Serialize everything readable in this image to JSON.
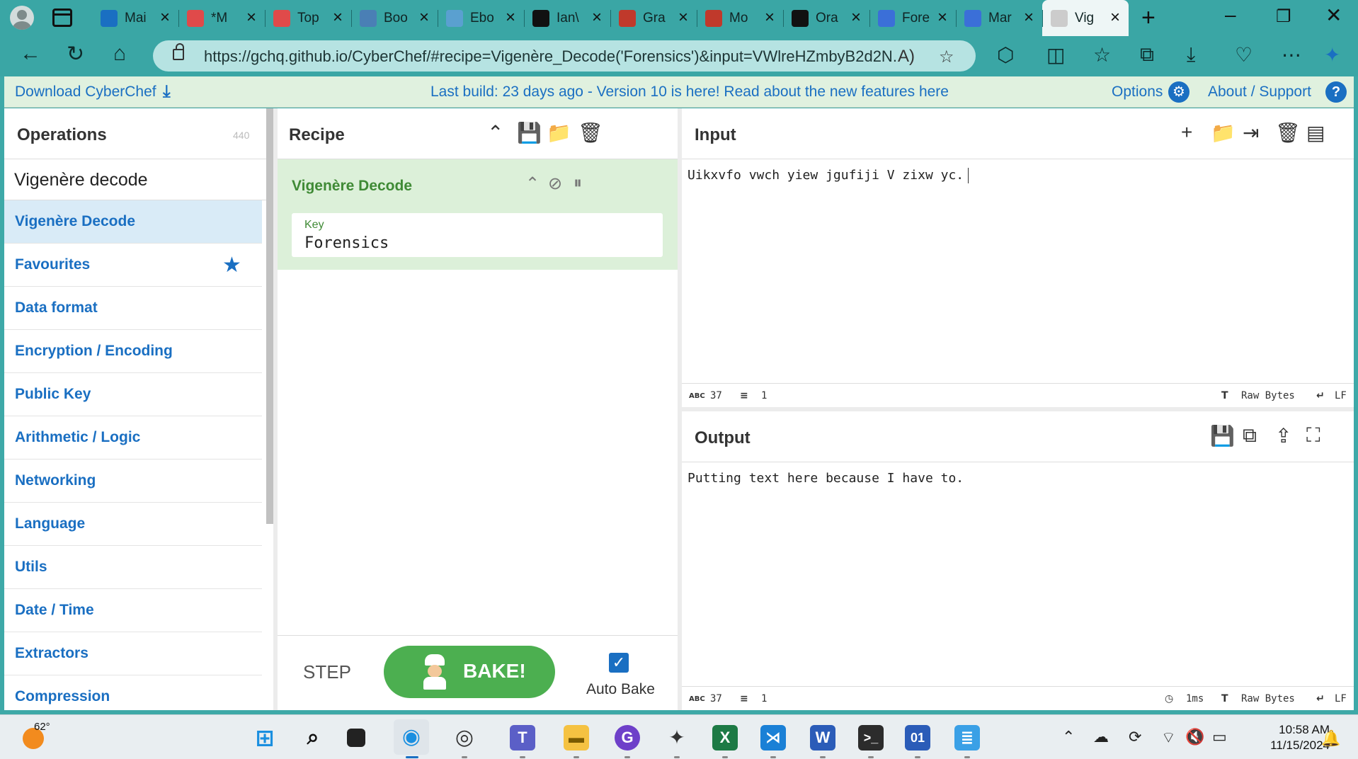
{
  "browser": {
    "tabs": [
      {
        "title": "Mai",
        "favicon_color": "#1a6fc2",
        "icon": "outlook-icon"
      },
      {
        "title": "*M",
        "favicon_color": "#e04a4a",
        "icon": "gear-favicon-icon"
      },
      {
        "title": "Top",
        "favicon_color": "#e04a4a",
        "icon": "gear-favicon-icon"
      },
      {
        "title": "Boo",
        "favicon_color": "#4a7fb5",
        "icon": "bookmark-favicon-icon"
      },
      {
        "title": "Ebo",
        "favicon_color": "#5aa0d0",
        "icon": "book-favicon-icon"
      },
      {
        "title": "Ian\\",
        "favicon_color": "#111111",
        "icon": "github-icon"
      },
      {
        "title": "Gra",
        "favicon_color": "#c0392b",
        "icon": "gear-favicon-icon"
      },
      {
        "title": "Mo",
        "favicon_color": "#c0392b",
        "icon": "gear-favicon-icon"
      },
      {
        "title": "Ora",
        "favicon_color": "#111111",
        "icon": "chatgpt-icon"
      },
      {
        "title": "Fore",
        "favicon_color": "#3b6fd8",
        "icon": "docs-icon"
      },
      {
        "title": "Mar",
        "favicon_color": "#3b6fd8",
        "icon": "docs-icon"
      },
      {
        "title": "Vig",
        "favicon_color": "#cccccc",
        "icon": "cyberchef-icon",
        "active": true
      }
    ],
    "url": "https://gchq.github.io/CyberChef/#recipe=Vigenère_Decode('Forensics')&input=VWlreHZmbyB2d2N..."
  },
  "banner": {
    "download_label": "Download CyberChef",
    "build_text": "Last build: 23 days ago - Version 10 is here! Read about the new features here",
    "options_label": "Options",
    "about_label": "About / Support"
  },
  "operations": {
    "title": "Operations",
    "count": "440",
    "search_value": "Vigenère decode",
    "items": [
      "Vigenère Decode",
      "Favourites",
      "Data format",
      "Encryption / Encoding",
      "Public Key",
      "Arithmetic / Logic",
      "Networking",
      "Language",
      "Utils",
      "Date / Time",
      "Extractors",
      "Compression"
    ]
  },
  "recipe": {
    "title": "Recipe",
    "operation_name": "Vigenère Decode",
    "key_label": "Key",
    "key_value": "Forensics",
    "step_label": "STEP",
    "bake_label": "BAKE!",
    "auto_bake_label": "Auto Bake",
    "auto_bake_checked": true
  },
  "input": {
    "title": "Input",
    "text": "Uikxvfo vwch yiew jgufiji V zixw yc.",
    "char_count": "37",
    "line_count": "1",
    "encoding": "Raw Bytes",
    "eol": "LF"
  },
  "output": {
    "title": "Output",
    "text": "Putting text here because I have to.",
    "char_count": "37",
    "line_count": "1",
    "time": "1ms",
    "encoding": "Raw Bytes",
    "eol": "LF"
  },
  "taskbar": {
    "temperature": "62°",
    "time": "10:58 AM",
    "date": "11/15/2024"
  },
  "colors": {
    "accent": "#1a6fc2",
    "recipe_green": "#3f8a35",
    "bake_button": "#4caf50",
    "browser_frame": "#3aa6a5"
  }
}
